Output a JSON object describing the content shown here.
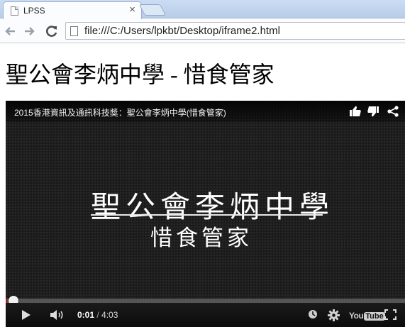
{
  "browser": {
    "tab_title": "LPSS",
    "tab_close": "×",
    "url": "file:///C:/Users/lpkbt/Desktop/iframe2.html"
  },
  "page": {
    "heading": "聖公會李炳中學 - 惜食管家"
  },
  "video": {
    "title": "2015香港資訊及通訊科技獎：聖公會李炳中學(惜食管家)",
    "frame_line1": "聖公會李炳中學",
    "frame_line2": "惜食管家",
    "current_time": "0:01",
    "separator": " / ",
    "duration": "4:03",
    "progress_fraction": 0.004,
    "logo_you": "You",
    "logo_tube": "Tube",
    "accent_color": "#cc181e"
  }
}
